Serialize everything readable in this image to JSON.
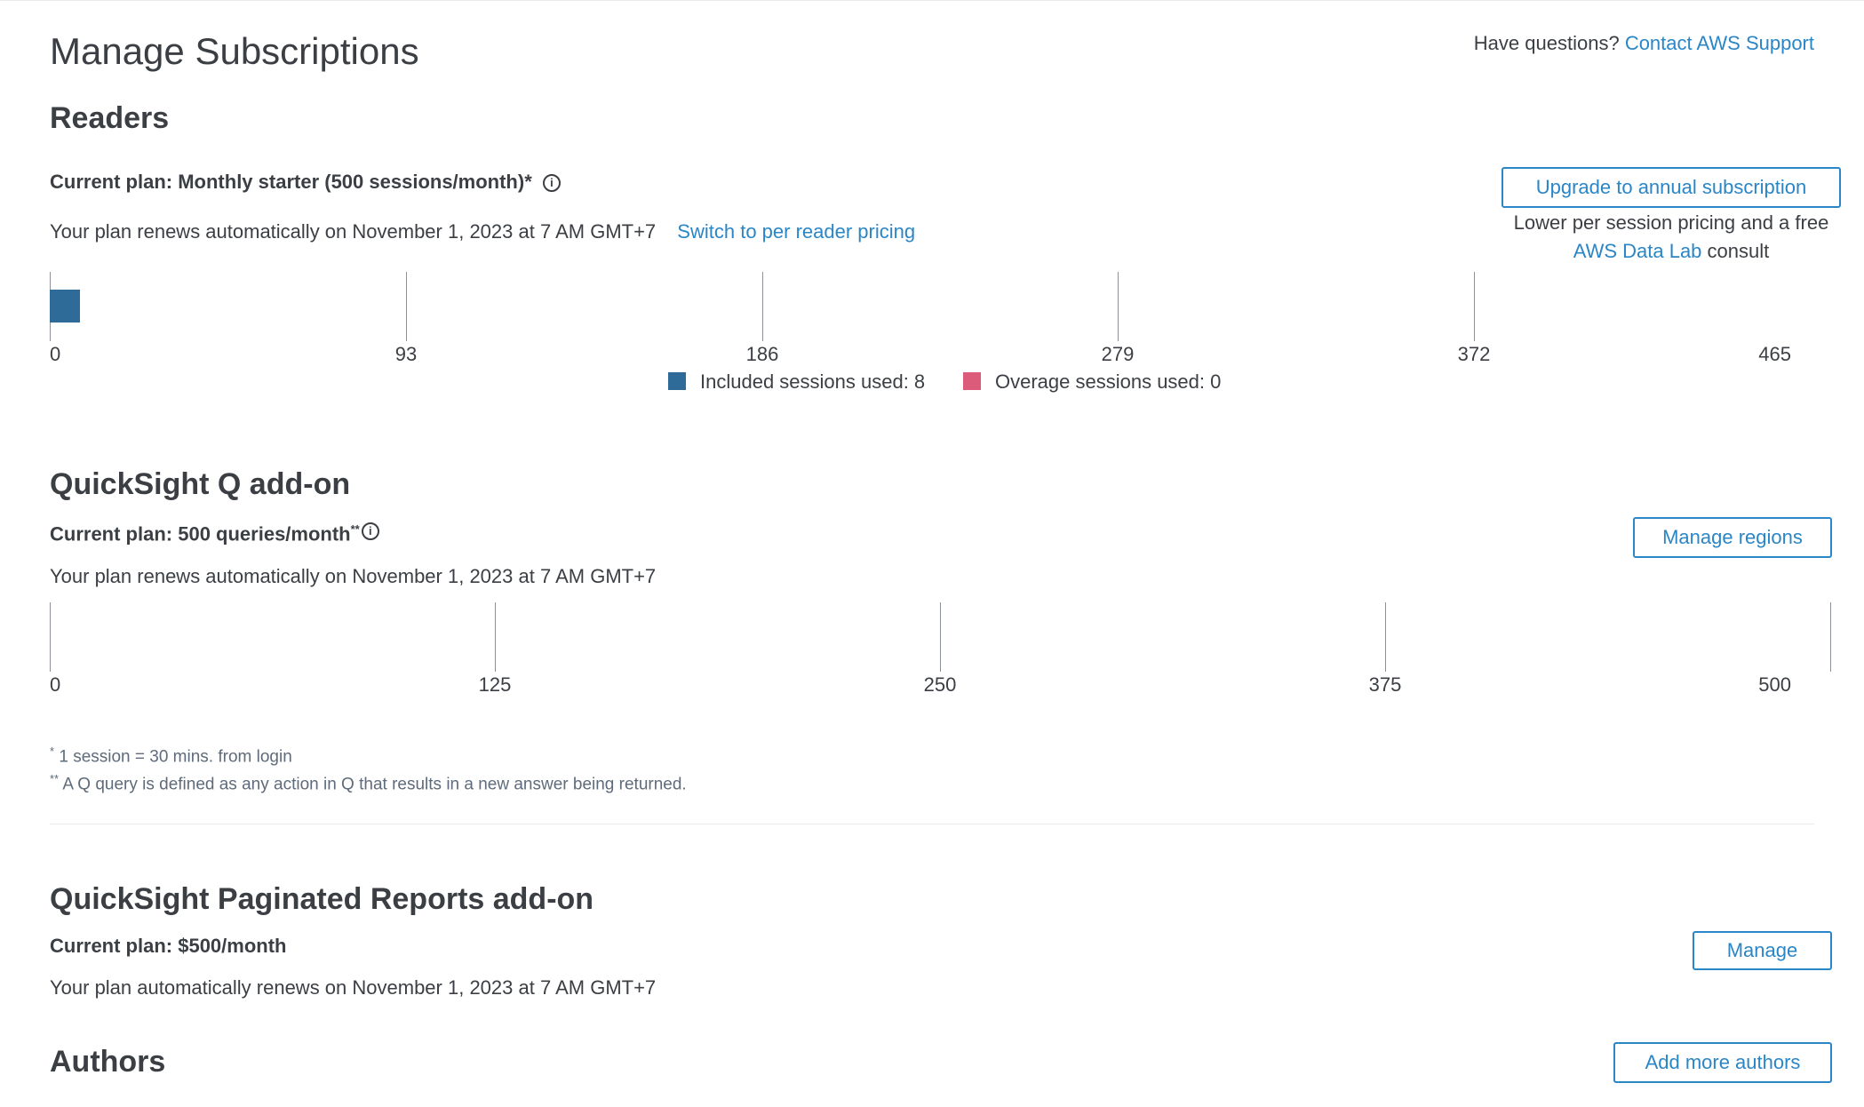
{
  "header": {
    "title": "Manage Subscriptions",
    "questions_prefix": "Have questions?",
    "contact_link": "Contact AWS Support"
  },
  "readers": {
    "heading": "Readers",
    "plan": "Current plan: Monthly starter (500 sessions/month)*",
    "renew": "Your plan renews automatically on November 1, 2023 at 7 AM GMT+7",
    "switch_link": "Switch to per reader pricing",
    "upgrade_button": "Upgrade to annual subscription",
    "upgrade_note_line1": "Lower per session pricing and a free",
    "upgrade_note_link": "AWS Data Lab",
    "upgrade_note_suffix": "consult",
    "chart": {
      "axis_min": 0,
      "axis_max": 465,
      "ticks": [
        "0",
        "93",
        "186",
        "279",
        "372",
        "465"
      ],
      "included_used": 8,
      "overage_used": 0,
      "legend": [
        {
          "label": "Included sessions used: 8",
          "color": "#2e6b99"
        },
        {
          "label": "Overage sessions used: 0",
          "color": "#dc5a7a"
        }
      ]
    }
  },
  "q_addon": {
    "heading": "QuickSight Q add-on",
    "plan": "Current plan: 500 queries/month",
    "plan_marker": "**",
    "renew": "Your plan renews automatically on November 1, 2023 at 7 AM GMT+7",
    "manage_button": "Manage regions",
    "chart": {
      "axis_min": 0,
      "axis_max": 500,
      "ticks": [
        "0",
        "125",
        "250",
        "375",
        "500"
      ]
    }
  },
  "footnotes": {
    "note1_marker": "*",
    "note1": "1 session = 30 mins. from login",
    "note2_marker": "**",
    "note2": "A Q query is defined as any action in Q that results in a new answer being returned."
  },
  "paginated": {
    "heading": "QuickSight Paginated Reports add-on",
    "plan": "Current plan: $500/month",
    "renew": "Your plan automatically renews on November 1, 2023 at 7 AM GMT+7",
    "manage_button": "Manage"
  },
  "authors": {
    "heading": "Authors",
    "add_button": "Add more authors"
  }
}
